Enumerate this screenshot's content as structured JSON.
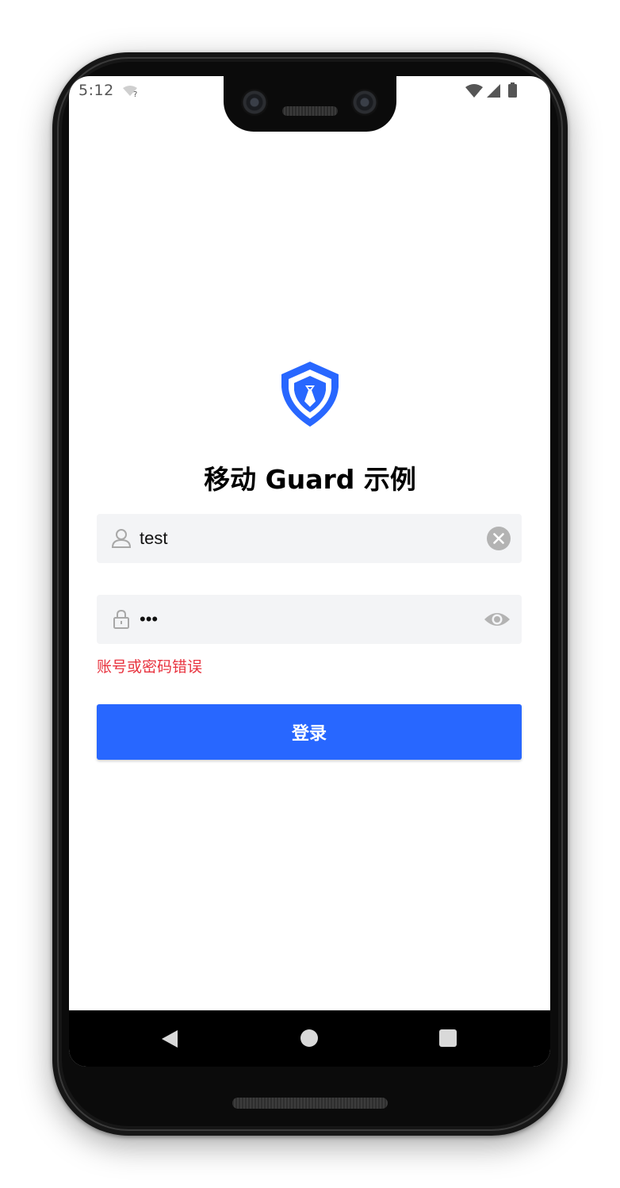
{
  "status_bar": {
    "time": "5:12",
    "wifi_question_icon": "wifi-question-icon",
    "wifi_icon": "wifi-alert-icon",
    "signal_icon": "cell-signal-icon",
    "battery_icon": "battery-icon"
  },
  "app": {
    "logo_icon": "shield-logo-icon",
    "title": "移动 Guard 示例",
    "brand_color": "#2867ff"
  },
  "form": {
    "username": {
      "value": "test",
      "leading_icon": "user-icon",
      "trailing_icon": "clear-icon"
    },
    "password": {
      "value": "•••",
      "leading_icon": "lock-icon",
      "trailing_icon": "eye-icon"
    },
    "error_message": "账号或密码错误",
    "error_color": "#e8333f",
    "submit_label": "登录"
  },
  "nav_bar": {
    "back_icon": "back-triangle-icon",
    "home_icon": "home-circle-icon",
    "recent_icon": "recent-square-icon"
  }
}
